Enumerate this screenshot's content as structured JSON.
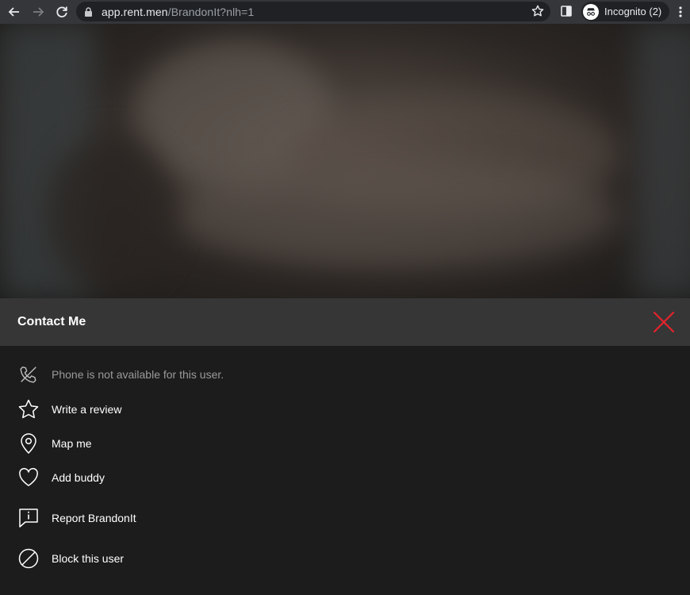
{
  "browser": {
    "url_host": "app.rent.men",
    "url_path": "/BrandonIt?nlh=1",
    "incognito_label": "Incognito (2)"
  },
  "contact": {
    "title": "Contact Me",
    "close_color": "#e4232c",
    "phone_status": "Phone is not available for this user.",
    "actions": [
      {
        "label": "Write a review",
        "icon": "star-icon"
      },
      {
        "label": "Map me",
        "icon": "map-pin-icon"
      },
      {
        "label": "Add buddy",
        "icon": "heart-icon"
      },
      {
        "label": "Report BrandonIt",
        "icon": "report-icon"
      },
      {
        "label": "Block this user",
        "icon": "block-icon"
      }
    ]
  }
}
